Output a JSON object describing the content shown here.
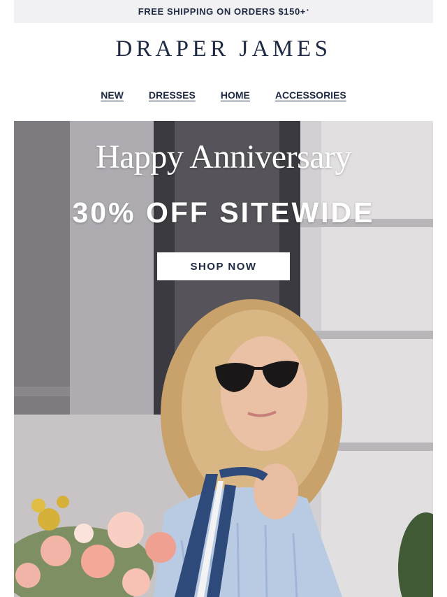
{
  "promo_bar": {
    "text": "FREE SHIPPING ON ORDERS $150+",
    "footnote_mark": "*"
  },
  "brand": {
    "logo_text": "DRAPER JAMES"
  },
  "nav": {
    "items": [
      {
        "label": "NEW"
      },
      {
        "label": "DRESSES"
      },
      {
        "label": "HOME"
      },
      {
        "label": "ACCESSORIES"
      }
    ]
  },
  "hero": {
    "title": "Happy Anniversary",
    "subtitle": "30% OFF SITEWIDE",
    "cta_label": "SHOP NOW",
    "image_subject": "woman-in-sunglasses-with-flowers-photo"
  },
  "colors": {
    "brand_navy": "#1f2a44",
    "promo_background": "#f1f1f3",
    "button_background": "#ffffff"
  }
}
